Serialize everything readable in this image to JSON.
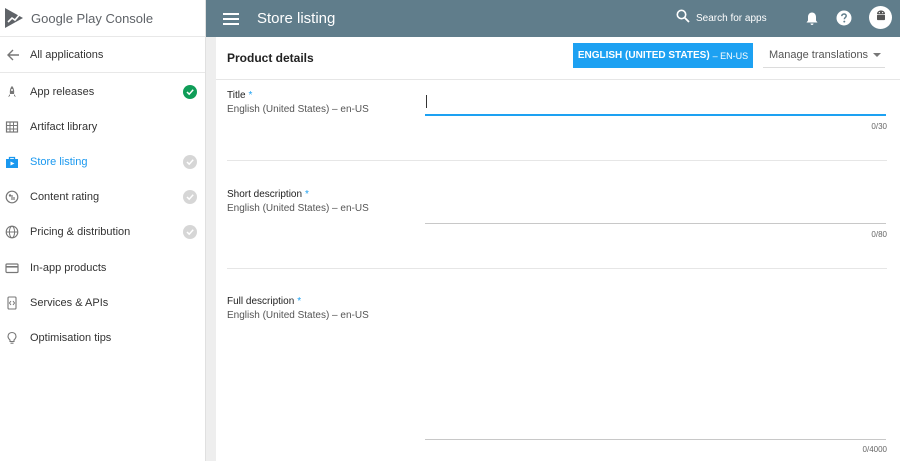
{
  "app": {
    "brand_main": "Google Play",
    "brand_sub": "Console"
  },
  "sidebar": {
    "back_label": "All applications",
    "items": [
      {
        "label": "App releases",
        "icon": "rocket-icon",
        "status": "complete"
      },
      {
        "label": "Artifact library",
        "icon": "grid-icon",
        "status": "none"
      },
      {
        "label": "Store listing",
        "icon": "store-icon",
        "status": "pending",
        "active": true
      },
      {
        "label": "Content rating",
        "icon": "rating-icon",
        "status": "pending"
      },
      {
        "label": "Pricing & distribution",
        "icon": "globe-icon",
        "status": "pending"
      },
      {
        "label": "In-app products",
        "icon": "card-icon",
        "status": "none"
      },
      {
        "label": "Services & APIs",
        "icon": "code-icon",
        "status": "none"
      },
      {
        "label": "Optimisation tips",
        "icon": "bulb-icon",
        "status": "none"
      }
    ]
  },
  "topbar": {
    "title": "Store listing",
    "search_label": "Search for apps"
  },
  "card": {
    "header": "Product details",
    "language_button": "ENGLISH (UNITED STATES)",
    "language_code": "– EN-US",
    "translations_label": "Manage translations"
  },
  "fields": {
    "title": {
      "label": "Title",
      "required": "*",
      "language": "English (United States) – en-US",
      "counter": "0/30"
    },
    "short": {
      "label": "Short description",
      "required": "*",
      "language": "English (United States) – en-US",
      "counter": "0/80"
    },
    "full": {
      "label": "Full description",
      "required": "*",
      "language": "English (United States) – en-US",
      "counter": "0/4000"
    }
  },
  "colors": {
    "topbar": "#607d8b",
    "accent": "#1da1f2",
    "complete": "#0f9d58"
  }
}
